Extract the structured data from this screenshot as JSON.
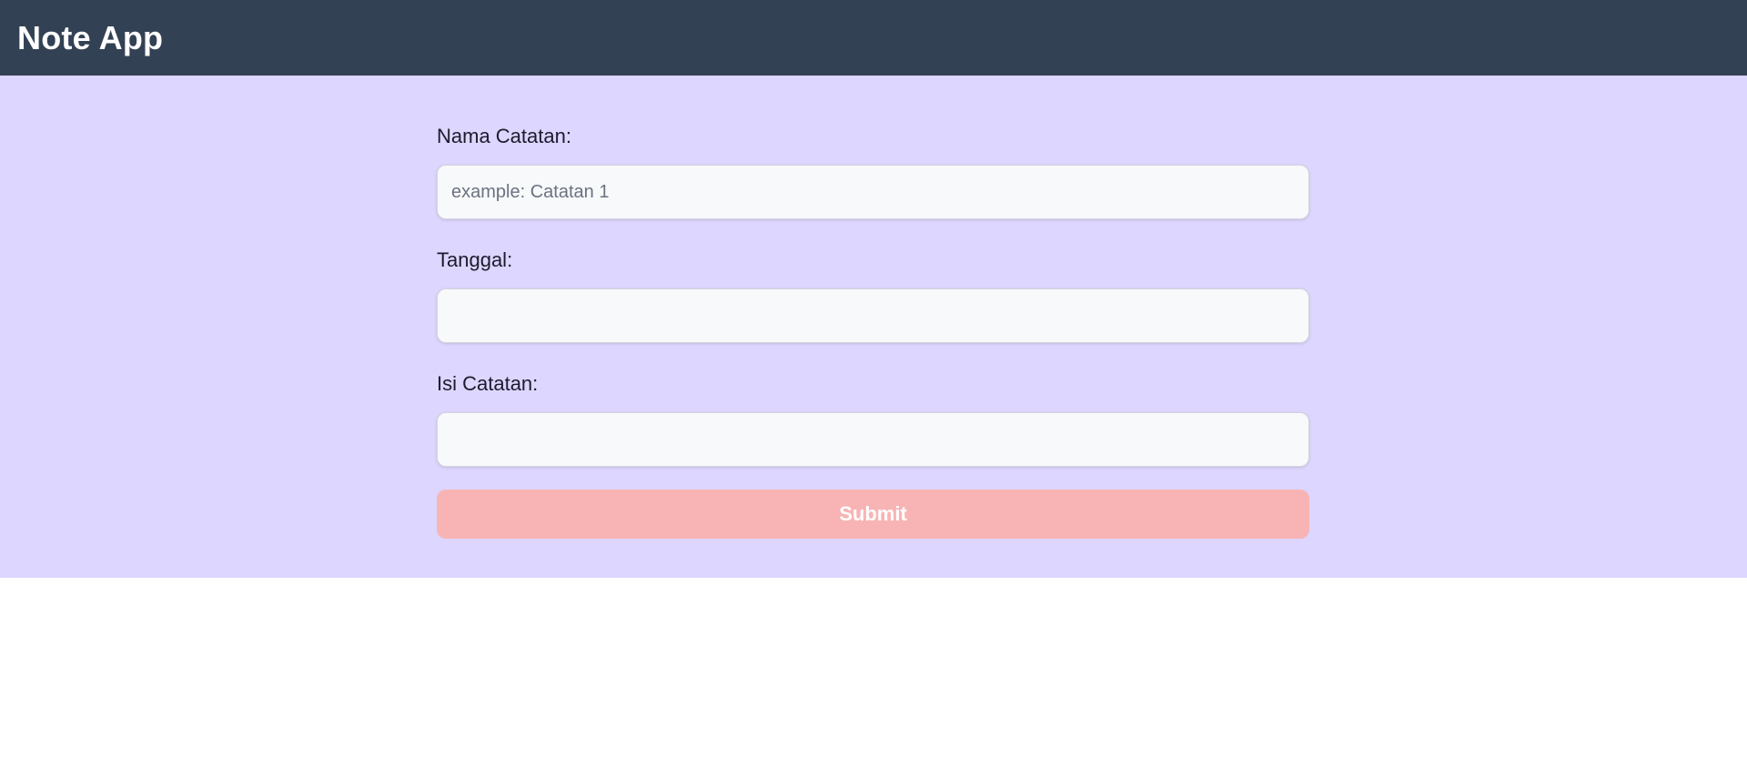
{
  "app": {
    "title": "Note App"
  },
  "form": {
    "name_label": "Nama Catatan:",
    "name_placeholder": "example: Catatan 1",
    "name_value": "",
    "date_label": "Tanggal:",
    "date_value": "",
    "content_label": "Isi Catatan:",
    "content_value": "",
    "submit_label": "Submit"
  },
  "colors": {
    "navbar_bg": "#334155",
    "form_bg": "#ddd6fe",
    "input_bg": "#f8f9fb",
    "submit_bg": "#f8b4b4"
  }
}
